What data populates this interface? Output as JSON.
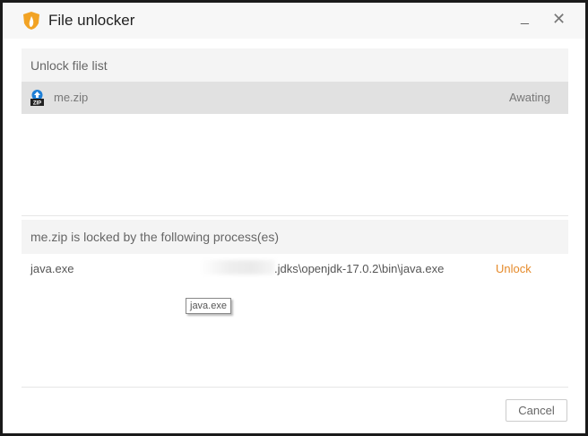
{
  "window": {
    "title": "File unlocker",
    "minimize": "_",
    "close": "✕"
  },
  "file_list": {
    "header": "Unlock file list",
    "items": [
      {
        "name": "me.zip",
        "status": "Awating",
        "icon": "zip-icon"
      }
    ]
  },
  "processes": {
    "header": "me.zip is locked by the following process(es)",
    "items": [
      {
        "name": "java.exe",
        "path": ".jdks\\openjdk-17.0.2\\bin\\java.exe",
        "action": "Unlock"
      }
    ],
    "tooltip": "java.exe"
  },
  "footer": {
    "cancel": "Cancel"
  },
  "colors": {
    "accent": "#e58a2a",
    "selected_row": "#e1e1e1"
  }
}
